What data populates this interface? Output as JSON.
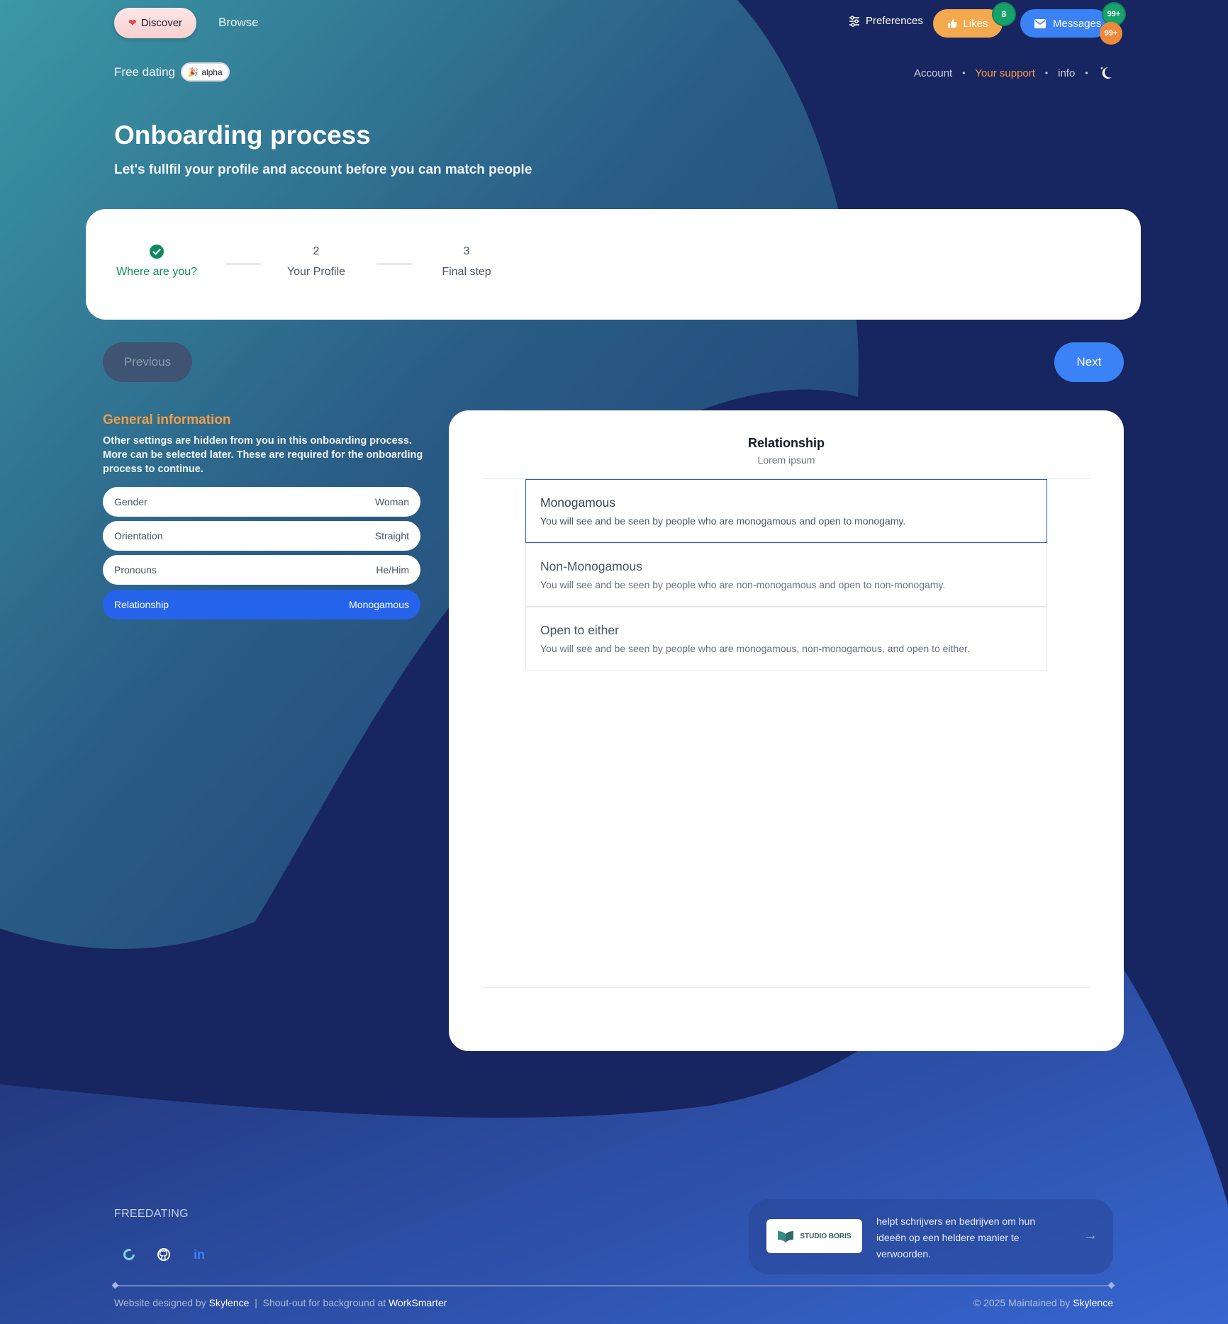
{
  "nav": {
    "discover_label": "Discover",
    "browse_label": "Browse",
    "preferences_label": "Preferences",
    "likes_label": "Likes",
    "likes_badge": "8",
    "messages_label": "Messages",
    "messages_badge_top": "99+",
    "messages_badge_bottom": "99+"
  },
  "brand": {
    "name": "Free dating",
    "tag": "alpha"
  },
  "toplinks": {
    "account": "Account",
    "support": "Your support",
    "info": "info"
  },
  "header": {
    "title": "Onboarding process",
    "subtitle": "Let's fullfil your profile and account before you can match people"
  },
  "stepper": {
    "steps": [
      {
        "number": "",
        "label": "Where are you?",
        "status": "done"
      },
      {
        "number": "2",
        "label": "Your Profile",
        "status": "pending"
      },
      {
        "number": "3",
        "label": "Final step",
        "status": "pending"
      }
    ]
  },
  "actions": {
    "previous_label": "Previous",
    "next_label": "Next"
  },
  "general_info": {
    "title": "General information",
    "description": "Other settings are hidden from you in this onboarding process. More can be selected later. These are required for the onboarding process to continue.",
    "rows": [
      {
        "label": "Gender",
        "value": "Woman"
      },
      {
        "label": "Orientation",
        "value": "Straight"
      },
      {
        "label": "Pronouns",
        "value": "He/Him"
      },
      {
        "label": "Relationship",
        "value": "Monogamous"
      }
    ]
  },
  "relationship": {
    "title": "Relationship",
    "subtitle": "Lorem ipsum",
    "options": [
      {
        "title": "Monogamous",
        "description": "You will see and be seen by people who are monogamous and open to monogamy."
      },
      {
        "title": "Non-Monogamous",
        "description": "You will see and be seen by people who are non-monogamous and open to non-monogamy."
      },
      {
        "title": "Open to either",
        "description": "You will see and be seen by people who are monogamous, non-monogamous, and open to either."
      }
    ]
  },
  "footer": {
    "brand": "FREEDATING",
    "promo_logo_text": "STUDIO BORIS",
    "promo_text": "helpt schrijvers en bedrijven om hun ideeën op een heldere manier te verwoorden.",
    "credits_prefix": "Website designed by",
    "credits_designer": "Skylence",
    "credits_sep": "|",
    "credits_bg_prefix": "Shout-out for background at",
    "credits_bg": "WorkSmarter",
    "copyright_prefix": "© 2025 Maintained by",
    "copyright_name": "Skylence"
  },
  "colors": {
    "accent_blue": "#3b82f6",
    "active_row": "#2563eb",
    "orange": "#f59c45",
    "success_green": "#0f8a5f",
    "background_dark": "#16255a"
  },
  "icons": {
    "discover": "heart-icon",
    "preferences": "sliders-icon",
    "likes": "thumbs-up-icon",
    "messages": "mail-icon",
    "alpha": "party-popper-icon",
    "theme": "moon-icon",
    "step_done": "check-circle-icon",
    "social": [
      "ring-logo-icon",
      "github-icon",
      "linkedin-icon"
    ],
    "promo": "arrow-right-icon"
  }
}
